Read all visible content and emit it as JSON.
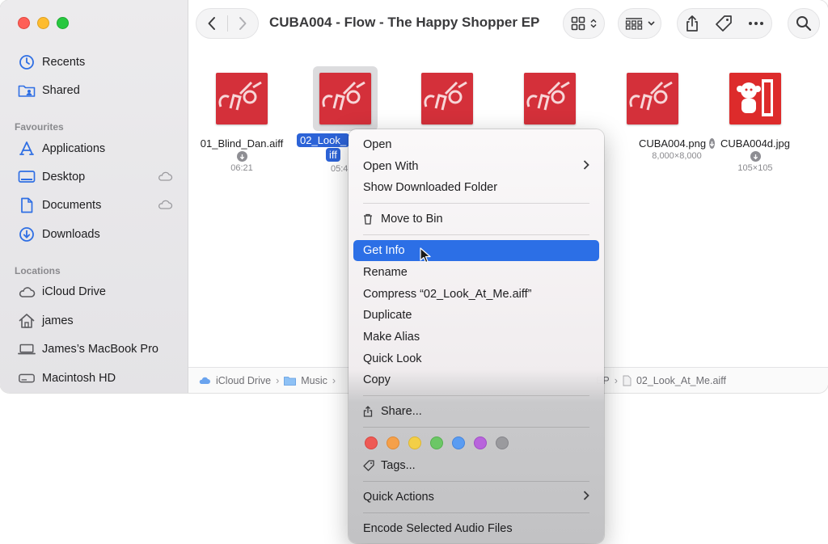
{
  "window": {
    "title": "CUBA004 - Flow - The Happy Shopper EP"
  },
  "sidebar": {
    "top_items": [
      {
        "label": "Recents",
        "icon": "clock-icon"
      },
      {
        "label": "Shared",
        "icon": "shared-folder-icon"
      }
    ],
    "sections": [
      {
        "title": "Favourites",
        "items": [
          {
            "label": "Applications",
            "icon": "applications-icon"
          },
          {
            "label": "Desktop",
            "icon": "desktop-icon",
            "cloud": true
          },
          {
            "label": "Documents",
            "icon": "document-icon",
            "cloud": true
          },
          {
            "label": "Downloads",
            "icon": "download-icon"
          }
        ]
      },
      {
        "title": "Locations",
        "items": [
          {
            "label": "iCloud Drive",
            "icon": "icloud-icon"
          },
          {
            "label": "james",
            "icon": "home-icon"
          },
          {
            "label": "James’s MacBook Pro",
            "icon": "laptop-icon"
          },
          {
            "label": "Macintosh HD",
            "icon": "hard-drive-icon"
          }
        ]
      }
    ]
  },
  "files": [
    {
      "name": "01_Blind_Dan.aiff",
      "meta": "06:21",
      "cloud_download": true,
      "kind": "cuba-logo"
    },
    {
      "name": "02_Look_",
      "name_line2": "iff",
      "meta": "05:4",
      "selected": true,
      "kind": "cuba-logo"
    },
    {
      "name": "",
      "meta": "",
      "kind": "cuba-logo"
    },
    {
      "name": "",
      "meta": "",
      "kind": "cuba-logo"
    },
    {
      "name": "CUBA004.png",
      "meta": "8,000×8,000",
      "cloud_download": true,
      "kind": "cuba-logo"
    },
    {
      "name": "CUBA004d.jpg",
      "meta": "105×105",
      "cloud_download": true,
      "kind": "monkey-004"
    }
  ],
  "pathbar": {
    "segments": [
      "iCloud Drive",
      "Music",
      "EP",
      "02_Look_At_Me.aiff"
    ]
  },
  "context_menu": {
    "items": {
      "open": "Open",
      "open_with": "Open With",
      "show_downloaded_folder": "Show Downloaded Folder",
      "move_to_bin": "Move to Bin",
      "get_info": "Get Info",
      "rename": "Rename",
      "compress": "Compress “02_Look_At_Me.aiff”",
      "duplicate": "Duplicate",
      "make_alias": "Make Alias",
      "quick_look": "Quick Look",
      "copy": "Copy",
      "share": "Share...",
      "tags": "Tags...",
      "quick_actions": "Quick Actions",
      "encode": "Encode Selected Audio Files"
    },
    "highlighted": "get_info",
    "tag_colors": [
      "#ee5a55",
      "#f5a04a",
      "#f3cf47",
      "#6cc766",
      "#5a9cf2",
      "#b864dc",
      "#9a9a9e"
    ]
  },
  "colors": {
    "accent": "#2c63d7",
    "thumb_red": "#d4303a"
  }
}
